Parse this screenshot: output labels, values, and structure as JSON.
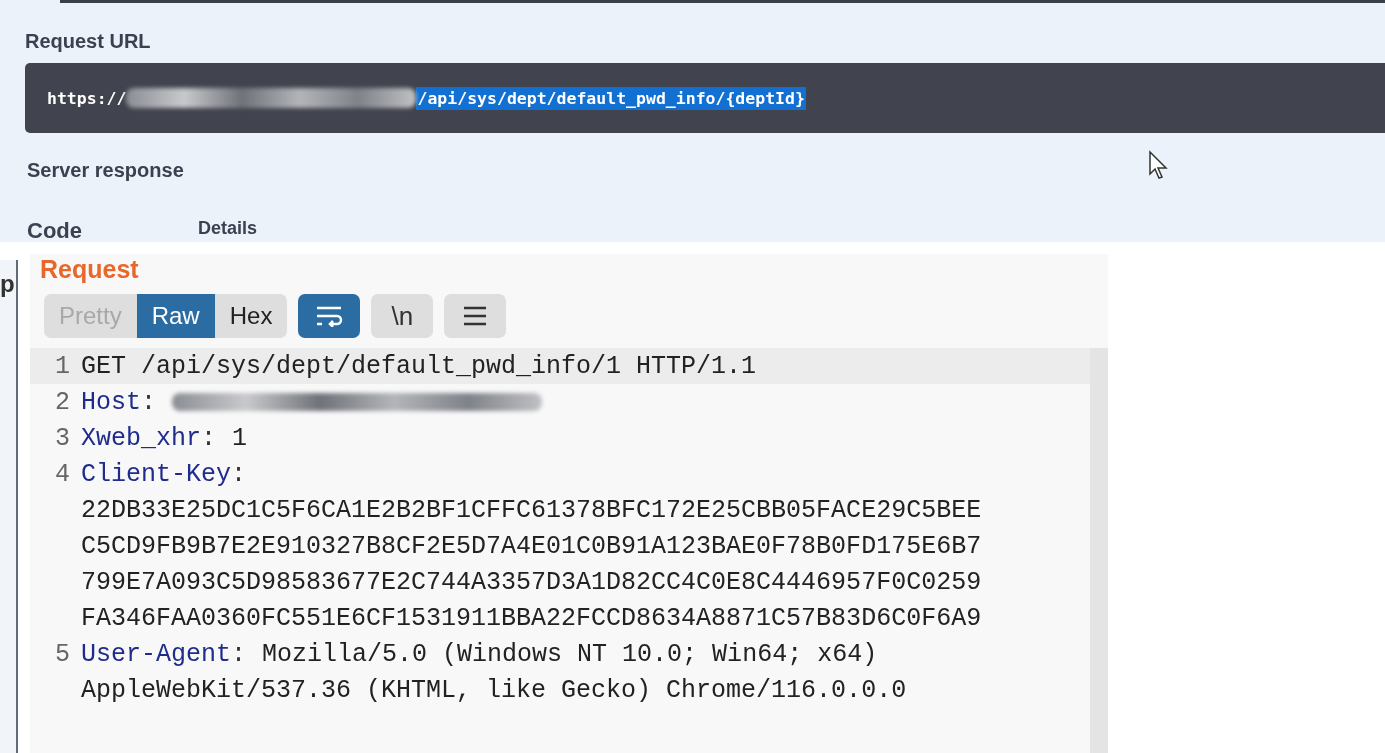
{
  "swagger": {
    "request_url_label": "Request URL",
    "url": {
      "scheme": "https://",
      "host_redacted": true,
      "path": "/api/sys/dept/default_pwd_info/{deptId}",
      "path_selected": true
    },
    "server_response_label": "Server response",
    "columns": [
      "Code",
      "Details"
    ]
  },
  "burp": {
    "side_letter": "p",
    "title": "Request",
    "view_tabs": [
      {
        "label": "Pretty",
        "selected": false
      },
      {
        "label": "Raw",
        "selected": true
      },
      {
        "label": "Hex",
        "selected": false
      }
    ],
    "toggles": [
      {
        "kind": "wrap",
        "on": true
      },
      {
        "kind": "newline",
        "label": "\\n",
        "on": false
      },
      {
        "kind": "menu",
        "on": false
      }
    ],
    "lines": [
      {
        "number": "1",
        "kind": "request",
        "text": "GET /api/sys/dept/default_pwd_info/1 HTTP/1.1",
        "selected": true
      },
      {
        "number": "2",
        "kind": "header",
        "name": "Host",
        "sep": ":",
        "redacted": true,
        "selected": false
      },
      {
        "number": "3",
        "kind": "header",
        "name": "Xweb_xhr",
        "sep": ":",
        "value": "1",
        "selected": false
      },
      {
        "number": "4",
        "kind": "header",
        "name": "Client-Key",
        "sep": ":",
        "continuation": [
          "22DB33E25DC1C5F6CA1E2B2BF1CFFC61378BFC172E25CBB05FACE29C5BEE",
          "C5CD9FB9B7E2E910327B8CF2E5D7A4E01C0B91A123BAE0F78B0FD175E6B7",
          "799E7A093C5D98583677E2C744A3357D3A1D82CC4C0E8C4446957F0C0259",
          "FA346FAA0360FC551E6CF1531911BBA22FCCD8634A8871C57B83D6C0F6A9"
        ],
        "selected": false
      },
      {
        "number": "5",
        "kind": "header",
        "name": "User-Agent",
        "sep": ":",
        "value": "Mozilla/5.0 (Windows NT 10.0; Win64; x64)",
        "continuation": [
          "AppleWebKit/537.36 (KHTML, like Gecko) Chrome/116.0.0.0"
        ],
        "selected": false
      }
    ]
  }
}
